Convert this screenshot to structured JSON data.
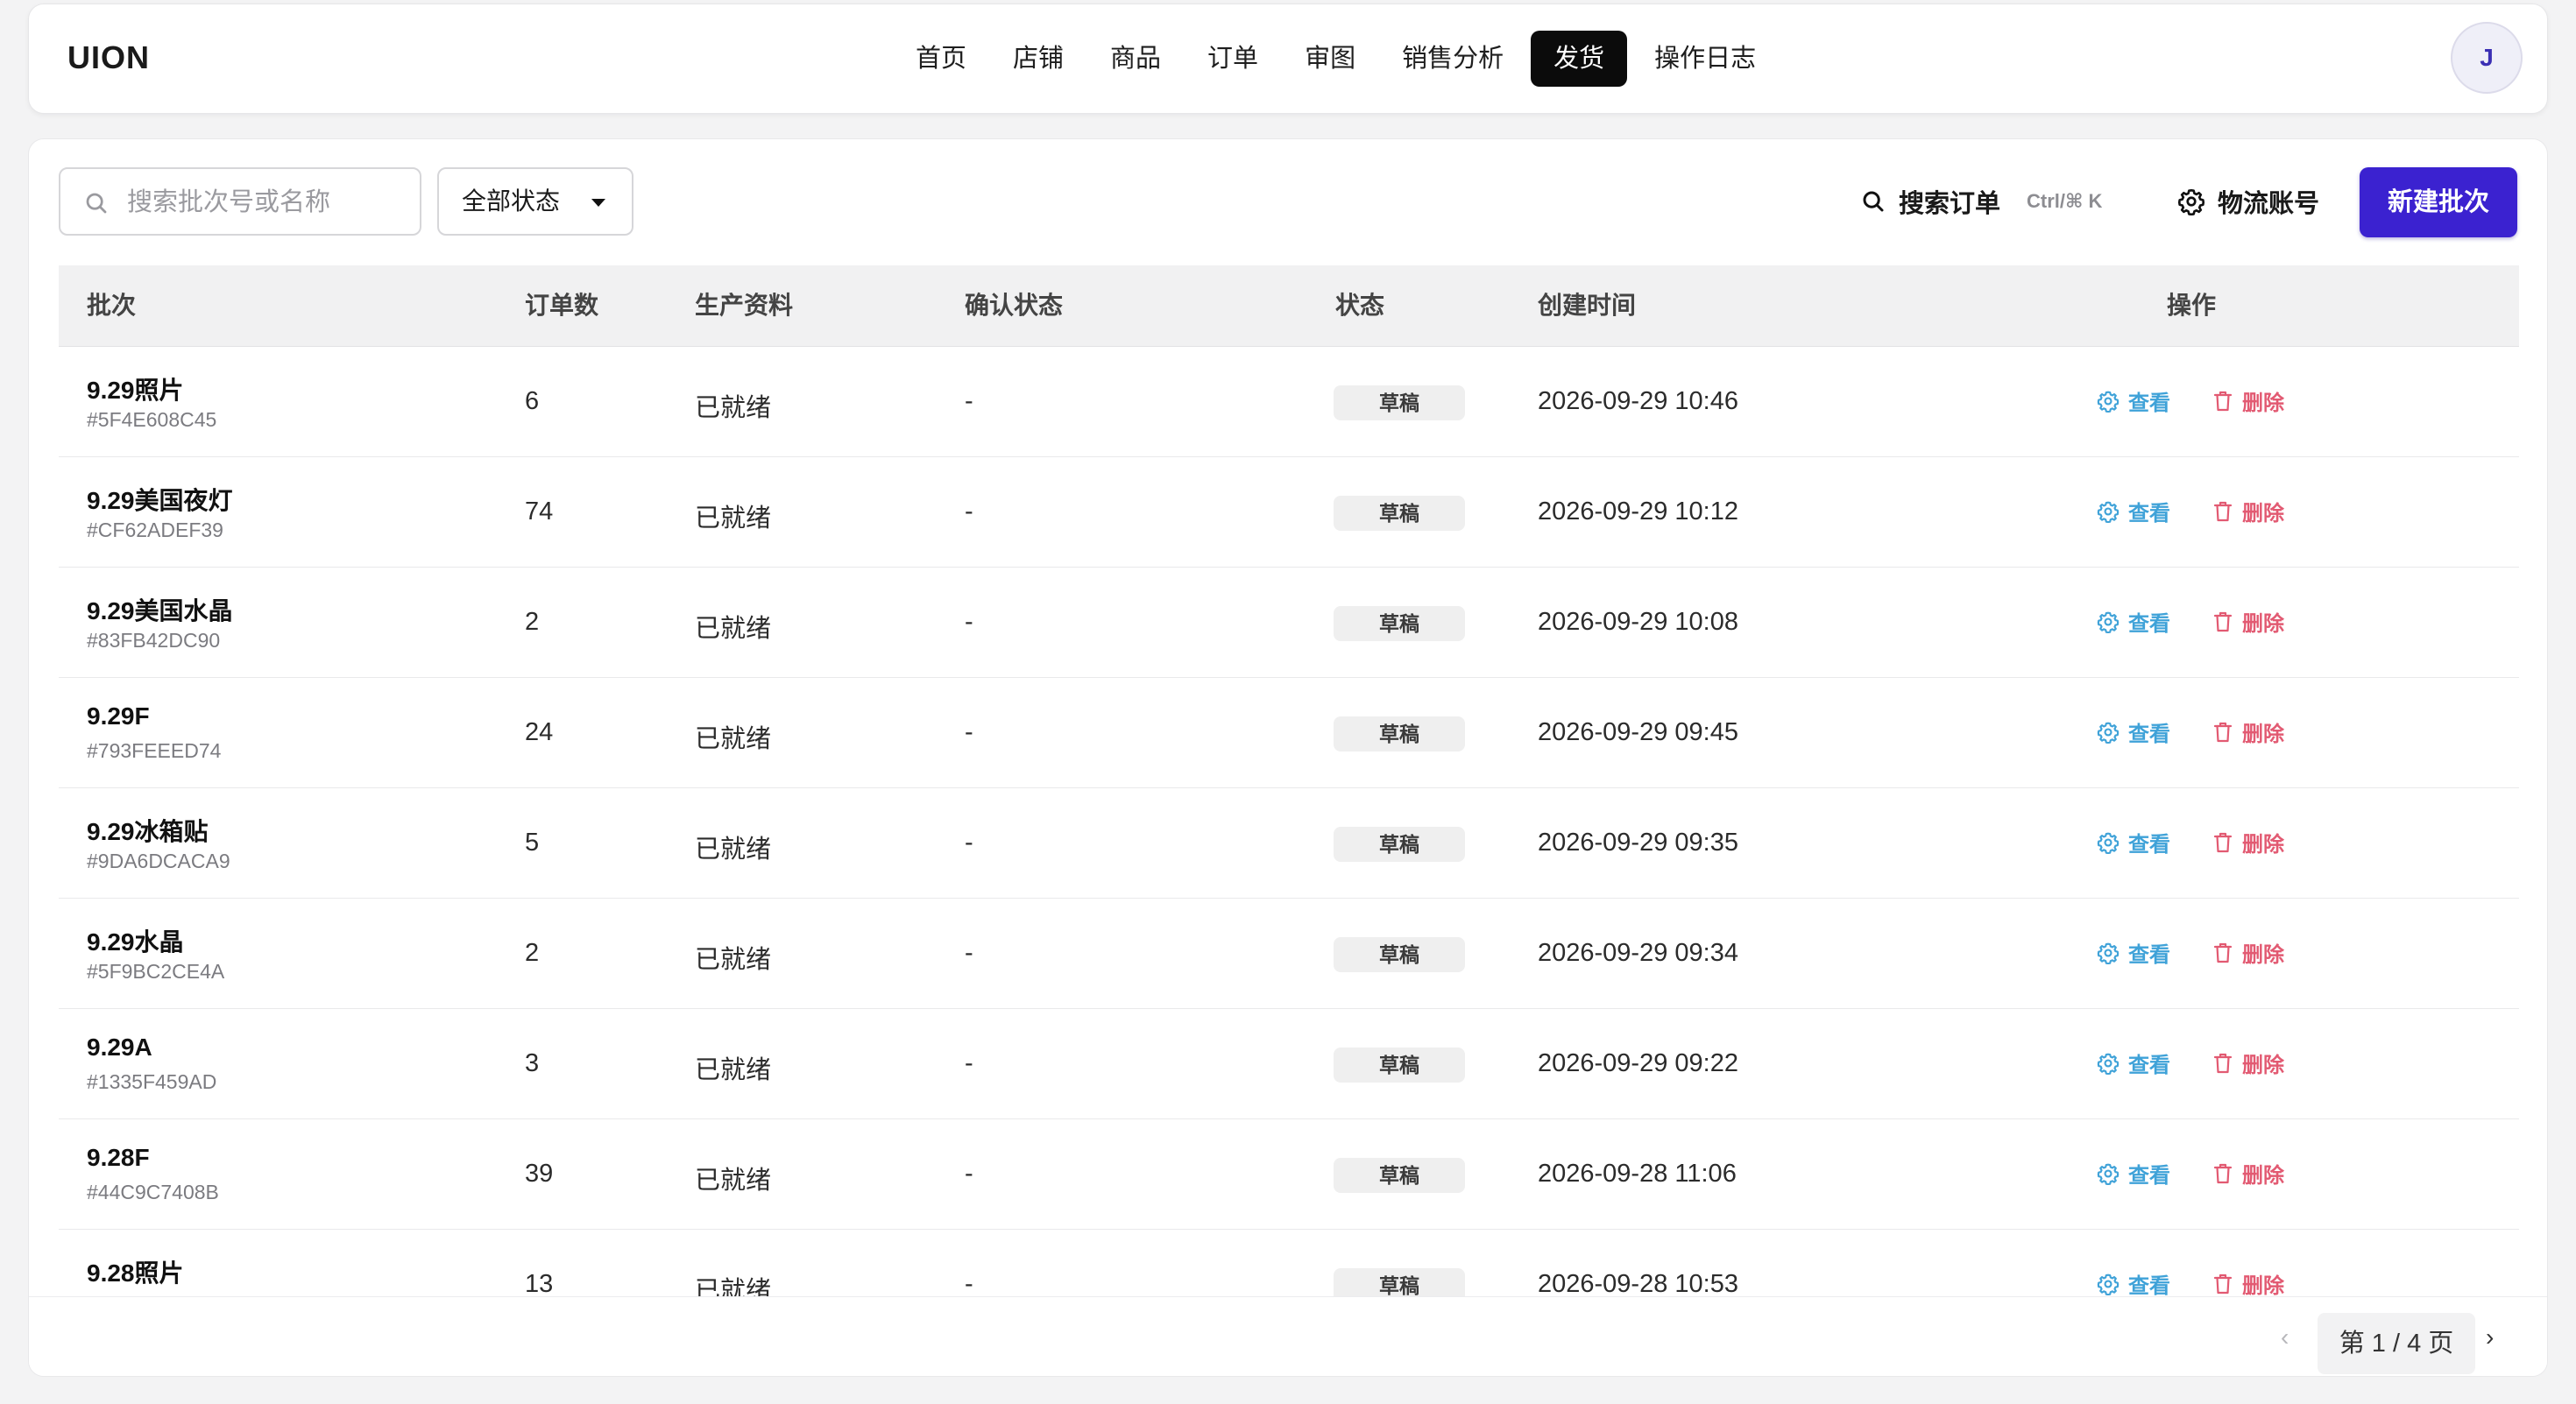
{
  "app": {
    "logo": "UION",
    "avatar_initial": "J"
  },
  "nav": {
    "items": [
      "首页",
      "店铺",
      "商品",
      "订单",
      "审图",
      "销售分析",
      "发货",
      "操作日志"
    ],
    "active_index": 6
  },
  "toolbar": {
    "search_placeholder": "搜索批次号或名称",
    "search_value": "",
    "status_filter": "全部状态",
    "search_orders_label": "搜索订单",
    "shortcut": "Ctrl/⌘ K",
    "logistics_label": "物流账号",
    "new_batch_label": "新建批次"
  },
  "table": {
    "headers": {
      "batch": "批次",
      "orders": "订单数",
      "production": "生产资料",
      "confirm": "确认状态",
      "status": "状态",
      "created": "创建时间",
      "actions": "操作"
    },
    "view_label": "查看",
    "delete_label": "删除",
    "rows": [
      {
        "name": "9.29照片",
        "id": "#5F4E608C45",
        "orders": "6",
        "production": "已就绪",
        "confirm": "-",
        "status": "草稿",
        "created": "2026-09-29 10:46"
      },
      {
        "name": "9.29美国夜灯",
        "id": "#CF62ADEF39",
        "orders": "74",
        "production": "已就绪",
        "confirm": "-",
        "status": "草稿",
        "created": "2026-09-29 10:12"
      },
      {
        "name": "9.29美国水晶",
        "id": "#83FB42DC90",
        "orders": "2",
        "production": "已就绪",
        "confirm": "-",
        "status": "草稿",
        "created": "2026-09-29 10:08"
      },
      {
        "name": "9.29F",
        "id": "#793FEEED74",
        "orders": "24",
        "production": "已就绪",
        "confirm": "-",
        "status": "草稿",
        "created": "2026-09-29 09:45"
      },
      {
        "name": "9.29冰箱贴",
        "id": "#9DA6DCACA9",
        "orders": "5",
        "production": "已就绪",
        "confirm": "-",
        "status": "草稿",
        "created": "2026-09-29 09:35"
      },
      {
        "name": "9.29水晶",
        "id": "#5F9BC2CE4A",
        "orders": "2",
        "production": "已就绪",
        "confirm": "-",
        "status": "草稿",
        "created": "2026-09-29 09:34"
      },
      {
        "name": "9.29A",
        "id": "#1335F459AD",
        "orders": "3",
        "production": "已就绪",
        "confirm": "-",
        "status": "草稿",
        "created": "2026-09-29 09:22"
      },
      {
        "name": "9.28F",
        "id": "#44C9C7408B",
        "orders": "39",
        "production": "已就绪",
        "confirm": "-",
        "status": "草稿",
        "created": "2026-09-28 11:06"
      },
      {
        "name": "9.28照片",
        "id": "",
        "orders": "13",
        "production": "已就绪",
        "confirm": "-",
        "status": "草稿",
        "created": "2026-09-28 10:53"
      }
    ]
  },
  "pagination": {
    "label": "第 1 / 4 页"
  },
  "colors": {
    "accent": "#3b22d0",
    "view": "#3fa2d8",
    "delete": "#e25a72"
  }
}
